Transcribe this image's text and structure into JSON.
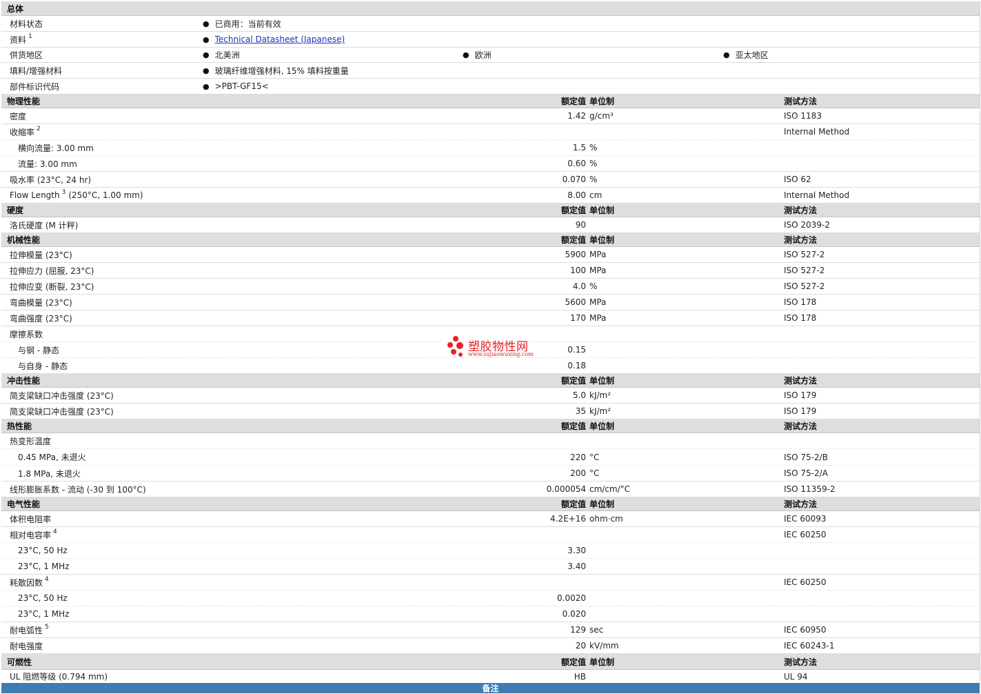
{
  "general": {
    "title": "总体",
    "rows": [
      {
        "label": "材料状态",
        "values": [
          "已商用：当前有效"
        ]
      },
      {
        "label": "资料",
        "sup": "1",
        "values": [
          "Technical Datasheet (Japanese)"
        ],
        "link": true
      },
      {
        "label": "供货地区",
        "values": [
          "北美洲",
          "欧洲",
          "亚太地区"
        ]
      },
      {
        "label": "填料/增强材料",
        "values": [
          "玻璃纤维增强材料, 15% 填料按重量"
        ]
      },
      {
        "label": "部件标识代码",
        "values": [
          ">PBT-GF15<"
        ]
      }
    ]
  },
  "columns": {
    "value": "额定值",
    "unit": "单位制",
    "method": "测试方法"
  },
  "sections": [
    {
      "title": "物理性能",
      "rows": [
        {
          "label": "密度",
          "value": "1.42",
          "unit": "g/cm³",
          "method": "ISO 1183"
        },
        {
          "label": "收缩率",
          "sup": "2",
          "method": "Internal Method",
          "children": [
            {
              "label": "横向流量: 3.00 mm",
              "value": "1.5",
              "unit": "%"
            },
            {
              "label": "流量: 3.00 mm",
              "value": "0.60",
              "unit": "%"
            }
          ]
        },
        {
          "label": "吸水率 (23°C, 24 hr)",
          "value": "0.070",
          "unit": "%",
          "method": "ISO 62"
        },
        {
          "label": "Flow Length",
          "sup": "3",
          "suffix": "(250°C, 1.00 mm)",
          "value": "8.00",
          "unit": "cm",
          "method": "Internal Method"
        }
      ]
    },
    {
      "title": "硬度",
      "rows": [
        {
          "label": "洛氏硬度 (M 计秤)",
          "value": "90",
          "method": "ISO 2039-2"
        }
      ]
    },
    {
      "title": "机械性能",
      "rows": [
        {
          "label": "拉伸模量 (23°C)",
          "value": "5900",
          "unit": "MPa",
          "method": "ISO 527-2"
        },
        {
          "label": "拉伸应力 (屈服, 23°C)",
          "value": "100",
          "unit": "MPa",
          "method": "ISO 527-2"
        },
        {
          "label": "拉伸应变 (断裂, 23°C)",
          "value": "4.0",
          "unit": "%",
          "method": "ISO 527-2"
        },
        {
          "label": "弯曲模量 (23°C)",
          "value": "5600",
          "unit": "MPa",
          "method": "ISO 178"
        },
        {
          "label": "弯曲强度 (23°C)",
          "value": "170",
          "unit": "MPa",
          "method": "ISO 178"
        },
        {
          "label": "摩擦系数",
          "children": [
            {
              "label": "与钢 - 静态",
              "value": "0.15"
            },
            {
              "label": "与自身 - 静态",
              "value": "0.18"
            }
          ]
        }
      ]
    },
    {
      "title": "冲击性能",
      "rows": [
        {
          "label": "简支梁缺口冲击强度 (23°C)",
          "value": "5.0",
          "unit": "kJ/m²",
          "method": "ISO 179"
        },
        {
          "label": "简支梁缺口冲击强度 (23°C)",
          "value": "35",
          "unit": "kJ/m²",
          "method": "ISO 179"
        }
      ]
    },
    {
      "title": "热性能",
      "rows": [
        {
          "label": "热变形温度",
          "children": [
            {
              "label": "0.45 MPa, 未退火",
              "value": "220",
              "unit": "°C",
              "method": "ISO 75-2/B"
            },
            {
              "label": "1.8 MPa, 未退火",
              "value": "200",
              "unit": "°C",
              "method": "ISO 75-2/A"
            }
          ]
        },
        {
          "label": "线形膨胀系数 - 流动 (-30 到 100°C)",
          "value": "0.000054",
          "unit": "cm/cm/°C",
          "method": "ISO 11359-2"
        }
      ]
    },
    {
      "title": "电气性能",
      "rows": [
        {
          "label": "体积电阻率",
          "value": "4.2E+16",
          "unit": "ohm·cm",
          "method": "IEC 60093"
        },
        {
          "label": "相对电容率",
          "sup": "4",
          "method": "IEC 60250",
          "children": [
            {
              "label": "23°C, 50 Hz",
              "value": "3.30"
            },
            {
              "label": "23°C, 1 MHz",
              "value": "3.40"
            }
          ]
        },
        {
          "label": "耗散因数",
          "sup": "4",
          "method": "IEC 60250",
          "children": [
            {
              "label": "23°C, 50 Hz",
              "value": "0.0020"
            },
            {
              "label": "23°C, 1 MHz",
              "value": "0.020"
            }
          ]
        },
        {
          "label": "耐电弧性",
          "sup": "5",
          "value": "129",
          "unit": "sec",
          "method": "IEC 60950"
        },
        {
          "label": "耐电强度",
          "value": "20",
          "unit": "kV/mm",
          "method": "IEC 60243-1"
        }
      ]
    },
    {
      "title": "可燃性",
      "rows": [
        {
          "label": "UL 阻燃等级 (0.794 mm)",
          "value": "HB",
          "method": "UL 94"
        }
      ]
    }
  ],
  "watermark": {
    "title": "塑胶物性网",
    "url": "www.sujiaowuxing.com",
    "color": "#e8202a"
  },
  "notes_bar": {
    "label": "备注",
    "color": "#3f7cb3"
  }
}
